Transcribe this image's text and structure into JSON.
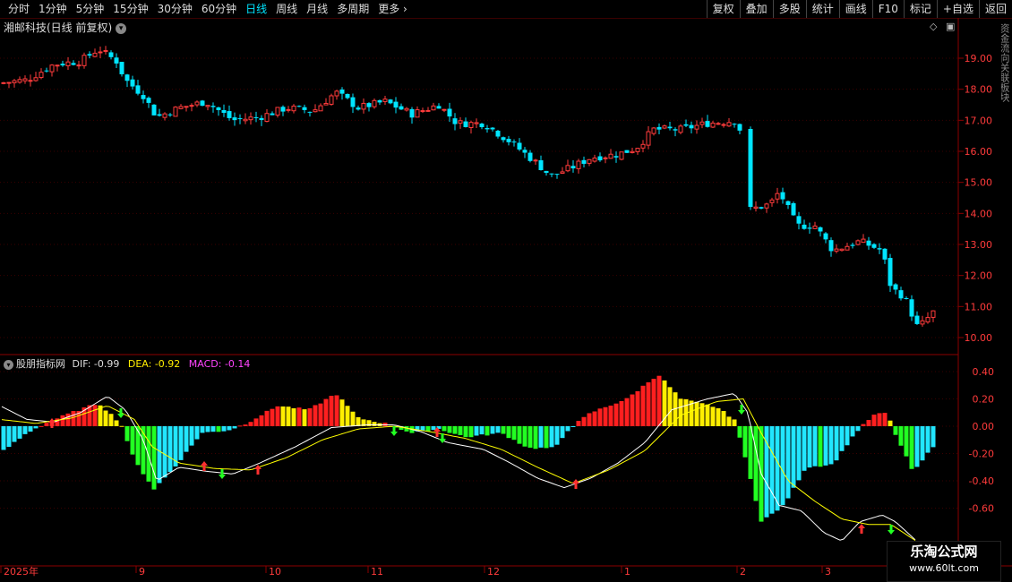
{
  "toolbar": {
    "periods": [
      "分时",
      "1分钟",
      "5分钟",
      "15分钟",
      "30分钟",
      "60分钟",
      "日线",
      "周线",
      "月线",
      "多周期",
      "更多"
    ],
    "active": "日线",
    "right_buttons": [
      "复权",
      "叠加",
      "多股",
      "统计",
      "画线",
      "F10",
      "标记",
      "+自选",
      "返回"
    ]
  },
  "stock_title": "湘邮科技(日线 前复权)",
  "indicator": {
    "name": "股朋指标网",
    "dif_label": "DIF: -0.99",
    "dea_label": "DEA: -0.92",
    "macd_label": "MACD: -0.14"
  },
  "price_axis": [
    "19.00",
    "18.00",
    "17.00",
    "16.00",
    "15.00",
    "14.00",
    "13.00",
    "12.00",
    "11.00",
    "10.00"
  ],
  "ind_axis": [
    "0.40",
    "0.20",
    "0.00",
    "-0.20",
    "-0.40",
    "-0.60"
  ],
  "date_axis": [
    "2025年",
    "9",
    "10",
    "11",
    "12",
    "1",
    "2",
    "3"
  ],
  "side_text": "资金流向关联板块",
  "watermark": {
    "line1": "乐淘公式网",
    "line2": "www.60lt.com"
  },
  "colors": {
    "up": "#ff3b3b",
    "down": "#00e5ff",
    "axis": "#8b0000",
    "dif": "#ffffff",
    "dea": "#ffff00",
    "bar_red": "#ff1f1f",
    "bar_yellow": "#ffee00",
    "bar_green": "#22ff22",
    "bar_cyan": "#22e6ff"
  }
}
